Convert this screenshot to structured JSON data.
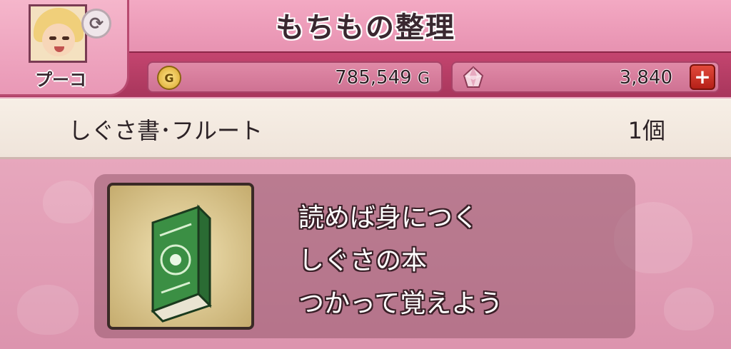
{
  "header": {
    "title": "もちもの整理",
    "character_name": "プーコ",
    "avatar_icon": "character-portrait",
    "swap_icon": "swap-character-icon"
  },
  "currency": {
    "gold_value": "785,549",
    "gold_unit": "G",
    "gold_icon_glyph": "G",
    "gem_value": "3,840",
    "plus_label": "+"
  },
  "item": {
    "name": "しぐさ書･フルート",
    "count": "1個",
    "icon": "green-book-icon",
    "description": [
      "読めば身につく",
      "しぐさの本",
      "つかって覚えよう"
    ]
  },
  "colors": {
    "header_pink": "#e792b1",
    "header_dark": "#b63d66",
    "item_row_bg": "#f4ebe2",
    "plus_red": "#c52a1e"
  }
}
